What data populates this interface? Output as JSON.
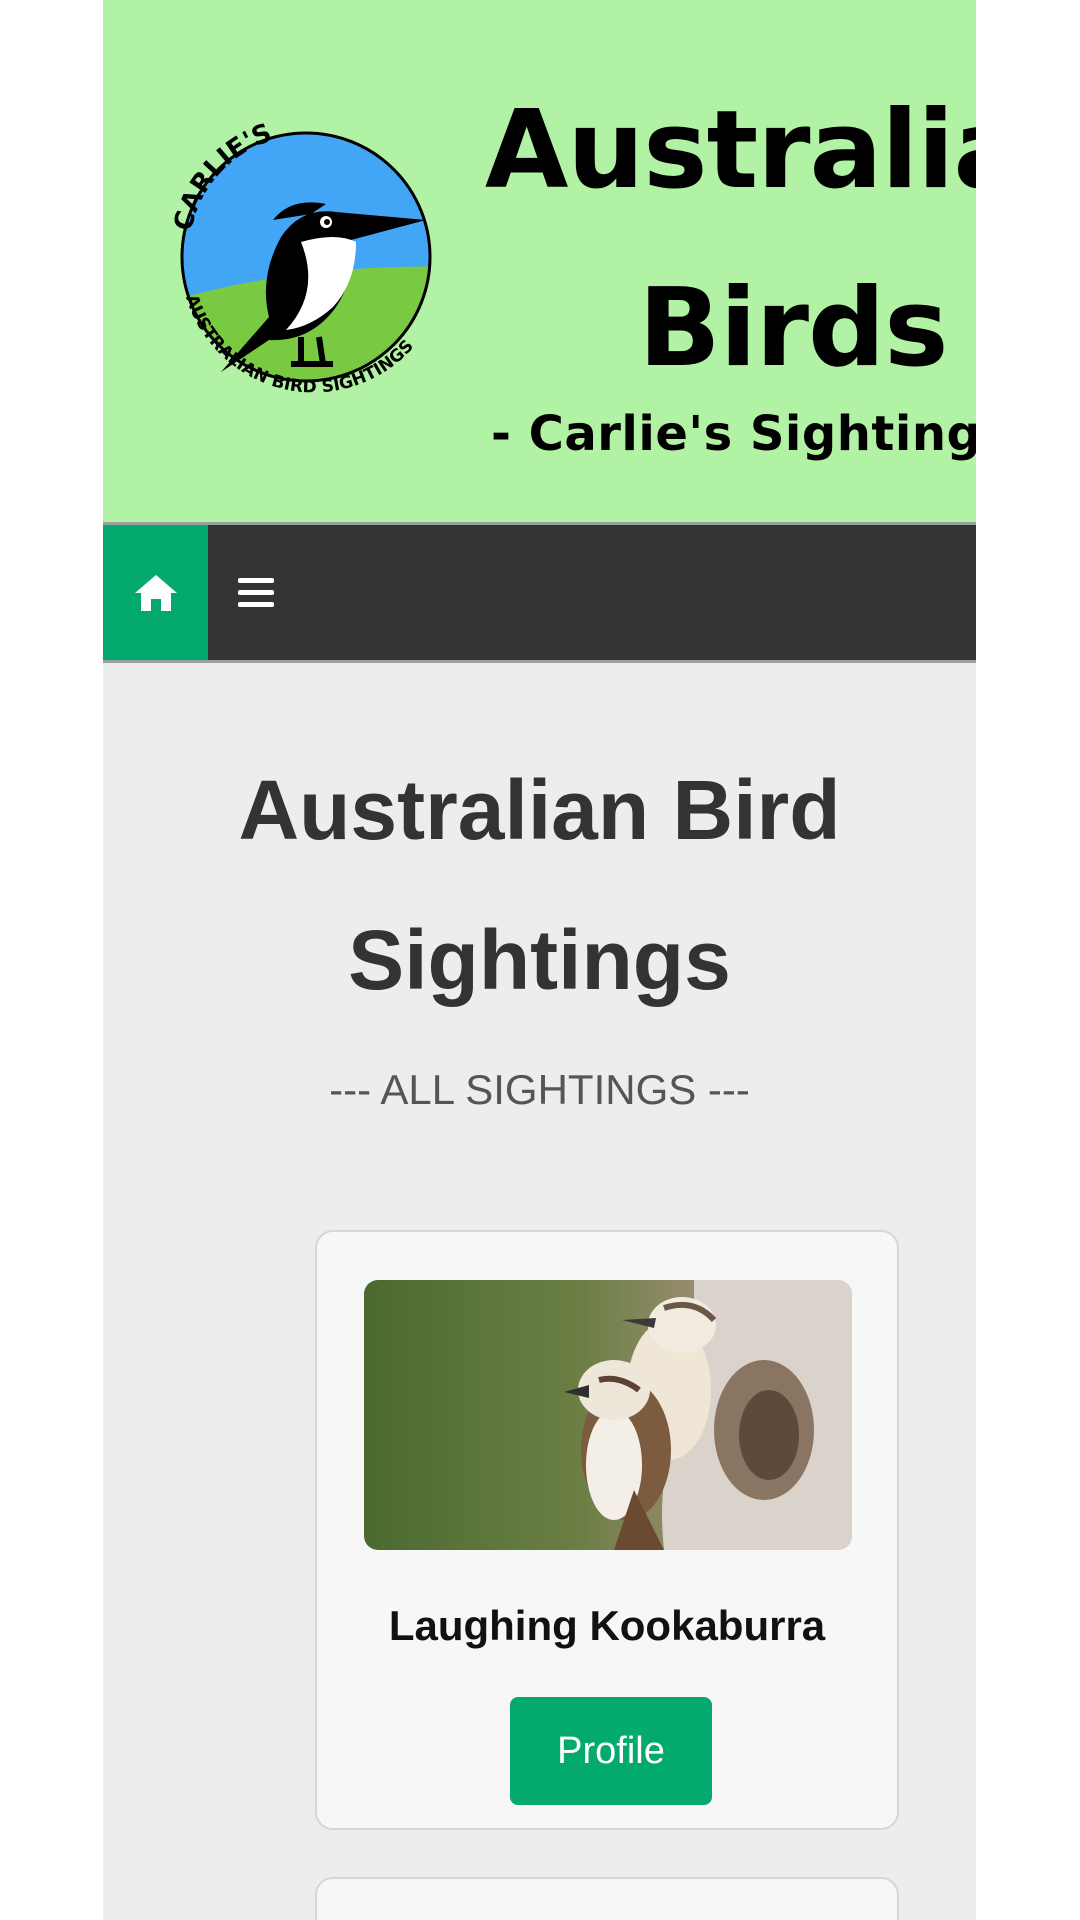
{
  "header": {
    "title_line1": "Australian",
    "title_line2": "Birds",
    "subtitle": "- Carlie's Sightings",
    "logo_text_top": "CARLIE'S",
    "logo_text_bottom": "AUSTRALIAN BIRD SIGHTINGS"
  },
  "nav": {
    "home_icon": "home-icon",
    "menu_icon": "hamburger-menu-icon",
    "accent_color": "#04aa6d"
  },
  "main": {
    "heading": "Australian Bird Sightings",
    "section_label": "--- ALL SIGHTINGS ---"
  },
  "cards": [
    {
      "name": "Laughing Kookaburra",
      "button_label": "Profile"
    }
  ]
}
